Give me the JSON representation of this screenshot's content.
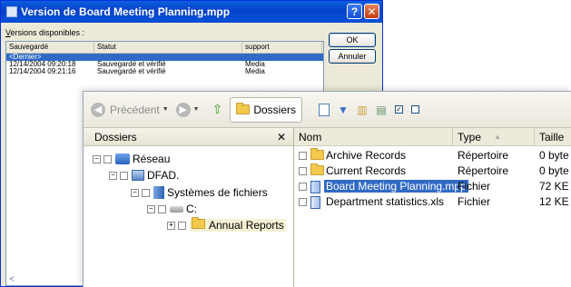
{
  "dialog": {
    "title": "Version de Board Meeting Planning.mpp",
    "help_glyph": "?",
    "close_glyph": "✕",
    "versions_label_key": "V",
    "versions_label_rest": "ersions disponibles :",
    "columns": [
      "Sauvegardé",
      "Statut",
      "support"
    ],
    "rows": [
      {
        "saved": "<Dernier>",
        "status": "",
        "support": "",
        "selected": true
      },
      {
        "saved": "12/14/2004 09:20:18",
        "status": "Sauvegardé et vérifié",
        "support": "Media"
      },
      {
        "saved": "12/14/2004 09:21:16",
        "status": "Sauvegardé et vérifié",
        "support": "Media"
      }
    ],
    "ok_label": "OK",
    "cancel_label": "Annuler",
    "scroll_left_glyph": "<"
  },
  "explorer": {
    "toolbar": {
      "back_label": "Précédent",
      "folders_label": "Dossiers"
    },
    "tree": {
      "header": "Dossiers",
      "close_glyph": "✕",
      "nodes": [
        {
          "label": "Réseau",
          "pm": "−",
          "icon": "network-icon"
        },
        {
          "label": "DFAD.",
          "pm": "−",
          "icon": "computer-icon"
        },
        {
          "label": "Systèmes de fichiers",
          "pm": "−",
          "icon": "filesystem-icon"
        },
        {
          "label": "C:",
          "pm": "−",
          "icon": "drive-icon"
        },
        {
          "label": "Annual Reports",
          "pm": "+",
          "icon": "folder-icon"
        }
      ]
    },
    "files": {
      "columns": {
        "name": "Nom",
        "type": "Type",
        "size": "Taille"
      },
      "sort_glyph": "▲",
      "rows": [
        {
          "name": "Archive Records",
          "type": "Répertoire",
          "size": "0 byte",
          "icon": "folder-icon"
        },
        {
          "name": "Current Records",
          "type": "Répertoire",
          "size": "0 byte",
          "icon": "folder-icon"
        },
        {
          "name": "Board Meeting Planning.mpp",
          "type": "Fichier",
          "size": "72 KE",
          "icon": "project-file-icon",
          "selected": true
        },
        {
          "name": "Department statistics.xls",
          "type": "Fichier",
          "size": "12 KE",
          "icon": "spreadsheet-file-icon"
        }
      ]
    }
  }
}
